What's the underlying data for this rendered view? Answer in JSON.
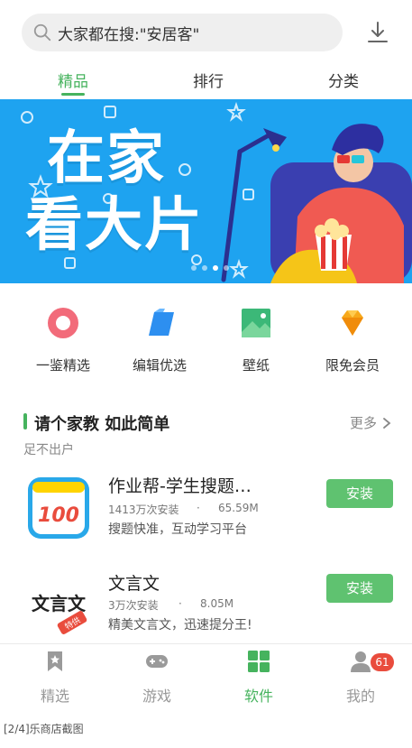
{
  "search": {
    "text": "大家都在搜:\"安居客\""
  },
  "tabs": [
    {
      "label": "精品",
      "active": true
    },
    {
      "label": "排行",
      "active": false
    },
    {
      "label": "分类",
      "active": false
    }
  ],
  "banner": {
    "line1": "在家",
    "line2": "看大片"
  },
  "categories": [
    {
      "label": "一鉴精选",
      "icon": "ring-icon"
    },
    {
      "label": "编辑优选",
      "icon": "flag-icon"
    },
    {
      "label": "壁纸",
      "icon": "wallpaper-icon"
    },
    {
      "label": "限免会员",
      "icon": "diamond-icon"
    }
  ],
  "section": {
    "title": "请个家教 如此简单",
    "more": "更多",
    "subtitle": "足不出户"
  },
  "apps": [
    {
      "name": "作业帮-学生搜题…",
      "downloads": "1413万次安装",
      "size": "65.59M",
      "desc": "搜题快准，互动学习平台",
      "install": "安装",
      "icon_text": "100"
    },
    {
      "name": "文言文",
      "downloads": "3万次安装",
      "size": "8.05M",
      "desc": "精美文言文，迅速提分王!",
      "install": "安装",
      "icon_text": "文言文",
      "icon_badge": "特供"
    }
  ],
  "bottom_nav": [
    {
      "label": "精选",
      "active": false
    },
    {
      "label": "游戏",
      "active": false
    },
    {
      "label": "软件",
      "active": true
    },
    {
      "label": "我的",
      "active": false,
      "badge": "61"
    }
  ],
  "caption": "[2/4]乐商店截图",
  "colors": {
    "accent": "#46b35e",
    "install": "#5fc270",
    "banner": "#1ea3f0",
    "badge": "#e94c3d"
  }
}
